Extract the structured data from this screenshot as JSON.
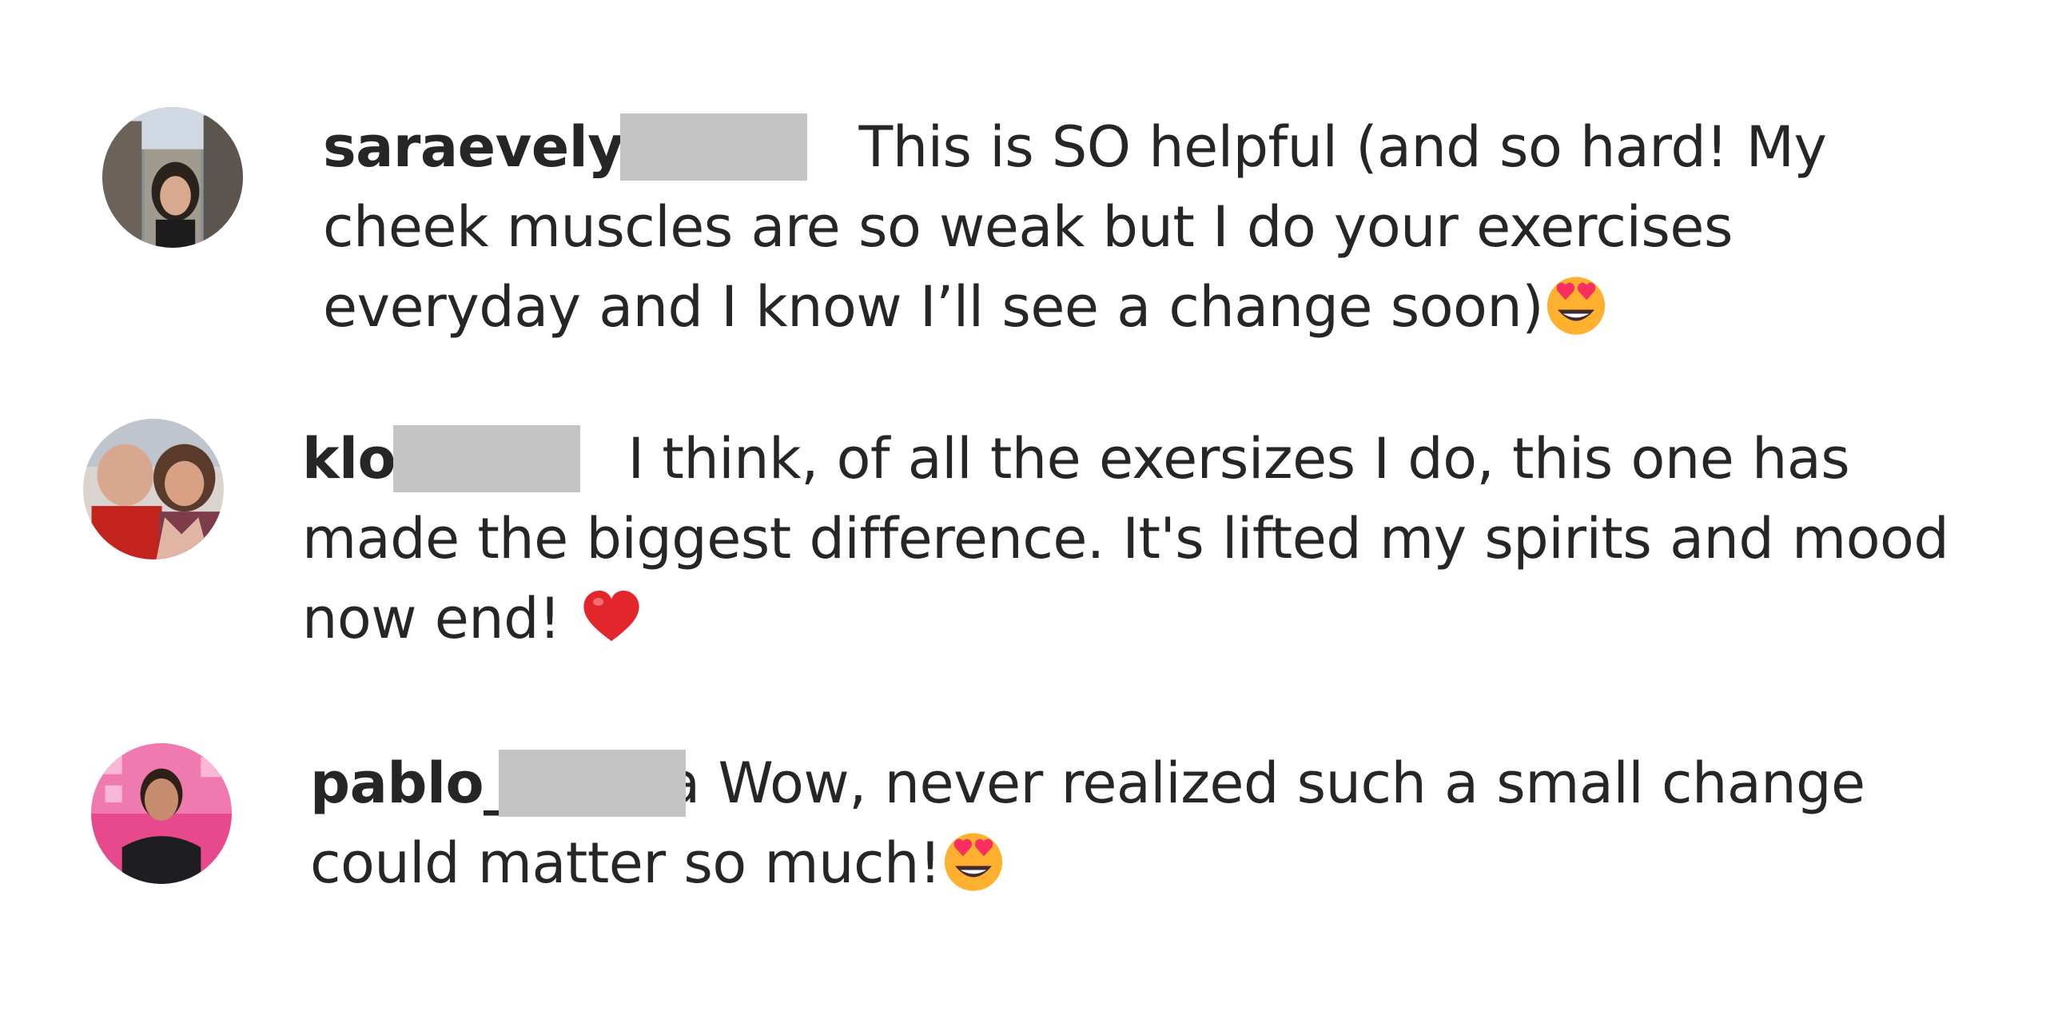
{
  "comments": [
    {
      "username": "saraevelyn",
      "text": "This is SO helpful (and so hard! My cheek muscles are so weak but I do your exercises everyday and I know I’ll see a change soon)",
      "emoji": "heart-eyes-icon"
    },
    {
      "username": "klog",
      "text": "I think, of all the exersizes I do, this one has made the biggest difference. It's lifted my spirits and mood now end!",
      "emoji": "red-heart-icon"
    },
    {
      "username": "pablo_c",
      "text": "a Wow, never realized such a small change could matter so much!",
      "emoji": "heart-eyes-icon"
    }
  ],
  "colors": {
    "text": "#262626",
    "redaction": "#c4c4c4",
    "emoji_yellow": "#ffb02e",
    "emoji_heart": "#f92f60"
  }
}
